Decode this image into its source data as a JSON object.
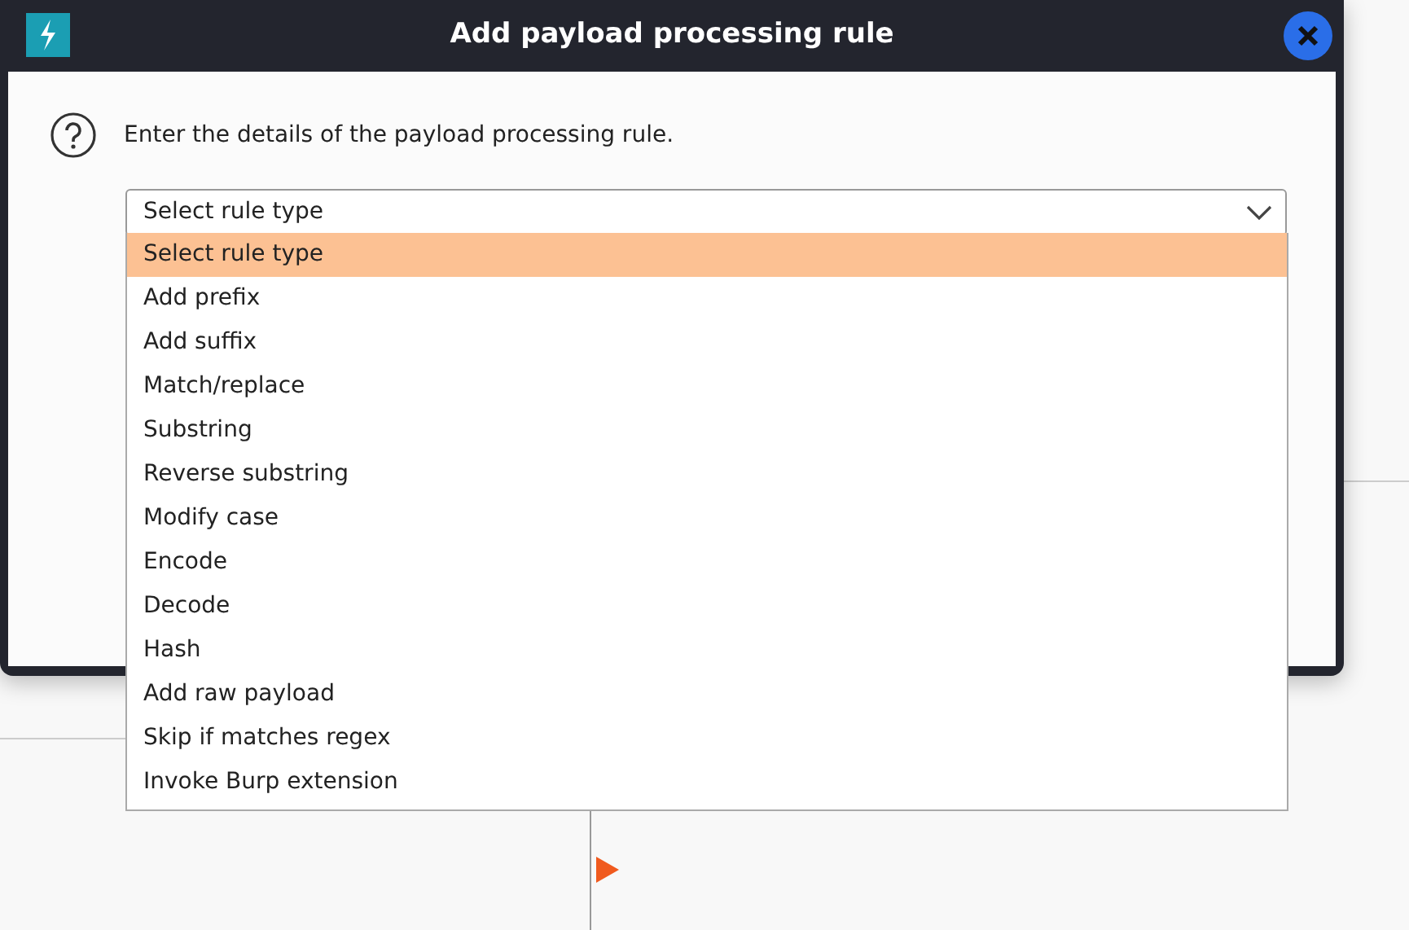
{
  "dialog": {
    "title": "Add payload processing rule",
    "message": "Enter the details of the payload processing rule.",
    "select": {
      "value": "Select rule type",
      "expanded": true,
      "options": [
        {
          "label": "Select rule type",
          "selected": true
        },
        {
          "label": "Add prefix",
          "selected": false
        },
        {
          "label": "Add suffix",
          "selected": false
        },
        {
          "label": "Match/replace",
          "selected": false
        },
        {
          "label": "Substring",
          "selected": false
        },
        {
          "label": "Reverse substring",
          "selected": false
        },
        {
          "label": "Modify case",
          "selected": false
        },
        {
          "label": "Encode",
          "selected": false
        },
        {
          "label": "Decode",
          "selected": false
        },
        {
          "label": "Hash",
          "selected": false
        },
        {
          "label": "Add raw payload",
          "selected": false
        },
        {
          "label": "Skip if matches regex",
          "selected": false
        },
        {
          "label": "Invoke Burp extension",
          "selected": false
        }
      ]
    }
  }
}
